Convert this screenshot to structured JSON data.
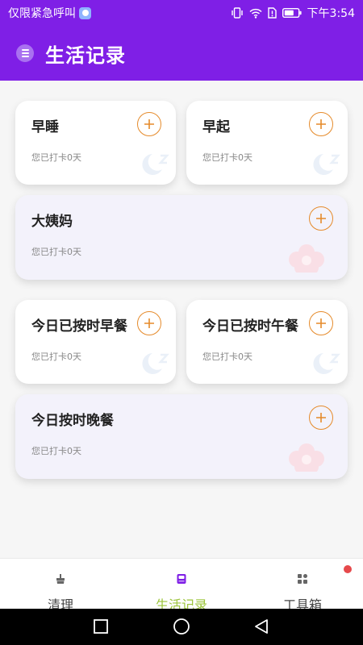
{
  "status_bar": {
    "left_text": "仅限紧急呼叫",
    "time": "下午3:54"
  },
  "header": {
    "title": "生活记录",
    "menu_icon": "menu-icon",
    "background": "#7f1fe6"
  },
  "cards": [
    {
      "title": "早睡",
      "subtitle": "您已打卡0天",
      "decoration": "moon-icon"
    },
    {
      "title": "早起",
      "subtitle": "您已打卡0天",
      "decoration": "moon-icon"
    },
    {
      "title": "大姨妈",
      "subtitle": "您已打卡0天",
      "decoration": "flower-icon"
    },
    {
      "title": "今日已按时早餐",
      "subtitle": "您已打卡0天",
      "decoration": "moon-icon"
    },
    {
      "title": "今日已按时午餐",
      "subtitle": "您已打卡0天",
      "decoration": "moon-icon"
    },
    {
      "title": "今日按时晚餐",
      "subtitle": "您已打卡0天",
      "decoration": "flower-icon"
    }
  ],
  "bottom_nav": {
    "items": [
      {
        "label": "清理",
        "icon": "broom-icon",
        "active": false
      },
      {
        "label": "生活记录",
        "icon": "notebook-icon",
        "active": true
      },
      {
        "label": "工具箱",
        "icon": "grid-icon",
        "active": false,
        "badge": true
      }
    ],
    "active_color": "#9bc43a"
  },
  "accent_color": "#e58a2a"
}
